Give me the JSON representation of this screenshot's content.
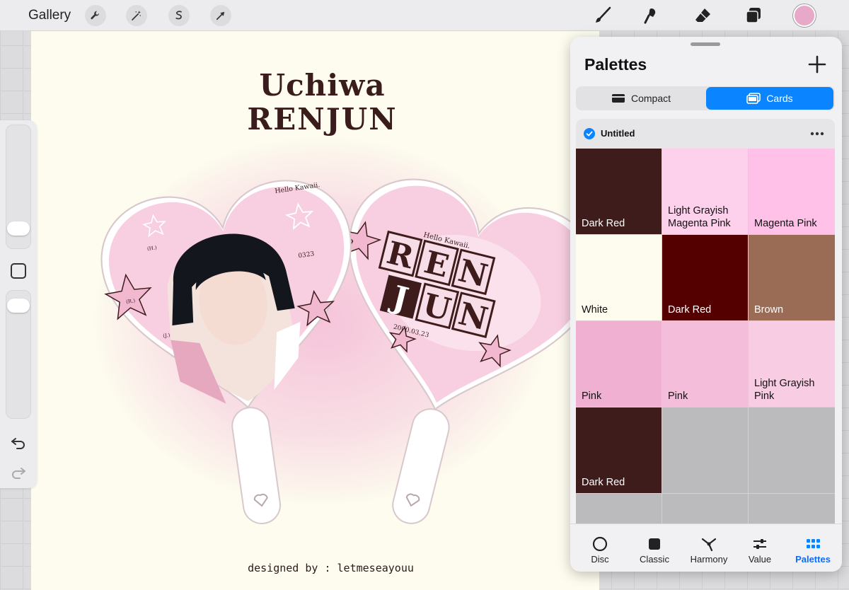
{
  "toolbar": {
    "gallery_label": "Gallery",
    "left_tools": [
      "wrench-icon",
      "magic-wand-icon",
      "selection-icon",
      "transform-arrow-icon"
    ],
    "right_tools": [
      "brush-icon",
      "smudge-icon",
      "eraser-icon",
      "layers-icon"
    ],
    "current_color": "#e8a8c8"
  },
  "canvas": {
    "title_line1": "Uchiwa",
    "title_line2": "RENJUN",
    "credit": "designed by : letmeseayouu",
    "fan_left": {
      "greeting": "Hello Kawaii.",
      "date_short": "0323",
      "initials": [
        "(H.)",
        "(R.)",
        "(J.)"
      ]
    },
    "fan_right": {
      "greeting": "Hello Kawaii.",
      "letters": [
        "R",
        "E",
        "N",
        "J",
        "U",
        "N"
      ],
      "date_full": "2000.03.23"
    }
  },
  "sidebar": {
    "icons": [
      "undo-icon",
      "redo-icon"
    ]
  },
  "palettes_panel": {
    "title": "Palettes",
    "view_modes": [
      {
        "label": "Compact",
        "active": false
      },
      {
        "label": "Cards",
        "active": true
      }
    ],
    "palette": {
      "name": "Untitled",
      "is_default": true,
      "swatches": [
        {
          "name": "Dark Red",
          "color": "#3e1c1c",
          "text_color": "#ffffff"
        },
        {
          "name": "Light Grayish Magenta Pink",
          "color": "#fdd0ec",
          "text_color": "#111111"
        },
        {
          "name": "Magenta Pink",
          "color": "#ffc1e8",
          "text_color": "#111111"
        },
        {
          "name": "White",
          "color": "#fdfcee",
          "text_color": "#111111"
        },
        {
          "name": "Dark Red",
          "color": "#540000",
          "text_color": "#ffffff"
        },
        {
          "name": "Brown",
          "color": "#9a6c55",
          "text_color": "#ffffff"
        },
        {
          "name": "Pink",
          "color": "#f0b0d2",
          "text_color": "#111111"
        },
        {
          "name": "Pink",
          "color": "#f4bedb",
          "text_color": "#111111"
        },
        {
          "name": "Light Grayish Pink",
          "color": "#f8cce2",
          "text_color": "#111111"
        },
        {
          "name": "Dark Red",
          "color": "#3e1c1c",
          "text_color": "#ffffff"
        },
        {
          "name": "",
          "color": "#bbbbbd",
          "text_color": "#111111"
        },
        {
          "name": "",
          "color": "#bbbbbd",
          "text_color": "#111111"
        },
        {
          "name": "",
          "color": "#bbbbbd",
          "text_color": "#111111"
        },
        {
          "name": "",
          "color": "#bbbbbd",
          "text_color": "#111111"
        },
        {
          "name": "",
          "color": "#bbbbbd",
          "text_color": "#111111"
        }
      ]
    },
    "tabs": [
      {
        "label": "Disc",
        "icon": "disc-icon",
        "active": false
      },
      {
        "label": "Classic",
        "icon": "classic-square-icon",
        "active": false
      },
      {
        "label": "Harmony",
        "icon": "harmony-icon",
        "active": false
      },
      {
        "label": "Value",
        "icon": "value-sliders-icon",
        "active": false
      },
      {
        "label": "Palettes",
        "icon": "palettes-grid-icon",
        "active": true
      }
    ],
    "accent_color": "#0a84ff"
  }
}
